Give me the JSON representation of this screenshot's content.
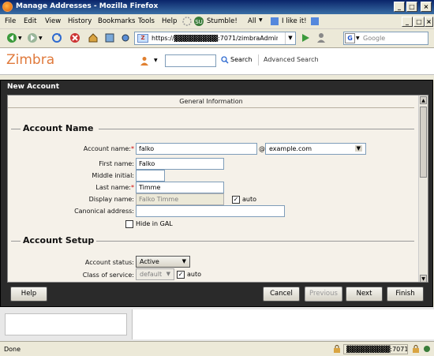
{
  "window": {
    "title": "Manage Addresses - Mozilla Firefox"
  },
  "menubar": {
    "items": [
      "File",
      "Edit",
      "View",
      "History",
      "Bookmarks",
      "Tools",
      "Help",
      "Stumble!",
      "All",
      "I like it!"
    ]
  },
  "navbar": {
    "url": "https://▓▓▓▓▓▓▓▓▓:7071/zimbraAdmin/",
    "search_placeholder": "Google"
  },
  "zimbra": {
    "logo": "Zimbra",
    "search_button": "Search",
    "advanced_search": "Advanced Search"
  },
  "dialog": {
    "title": "New Account",
    "tab_title": "General Information",
    "section_account_name": "Account Name",
    "section_account_setup": "Account Setup",
    "fields": {
      "account_name_label": "Account name:",
      "account_name_value": "falko",
      "at": "@",
      "domain_value": "example.com",
      "first_name_label": "First name:",
      "first_name_value": "Falko",
      "middle_initial_label": "Middle initial:",
      "middle_initial_value": "",
      "last_name_label": "Last name:",
      "last_name_value": "Timme",
      "display_name_label": "Display name:",
      "display_name_value": "Falko Timme",
      "display_auto_label": "auto",
      "canonical_label": "Canonical address:",
      "canonical_value": "",
      "hide_gal_label": "Hide in GAL",
      "account_status_label": "Account status:",
      "account_status_value": "Active",
      "cos_label": "Class of service:",
      "cos_value": "default",
      "cos_auto_label": "auto"
    },
    "buttons": {
      "help": "Help",
      "cancel": "Cancel",
      "previous": "Previous",
      "next": "Next",
      "finish": "Finish"
    }
  },
  "statusbar": {
    "status": "Done",
    "host": "▓▓▓▓▓▓▓▓▓:7071"
  },
  "colors": {
    "titlebar": "#0a246a",
    "dialog_frame": "#2a2a2a",
    "dialog_body": "#f5f1e9",
    "zimbra_brand": "#e07a3c",
    "required": "#cc0000"
  }
}
